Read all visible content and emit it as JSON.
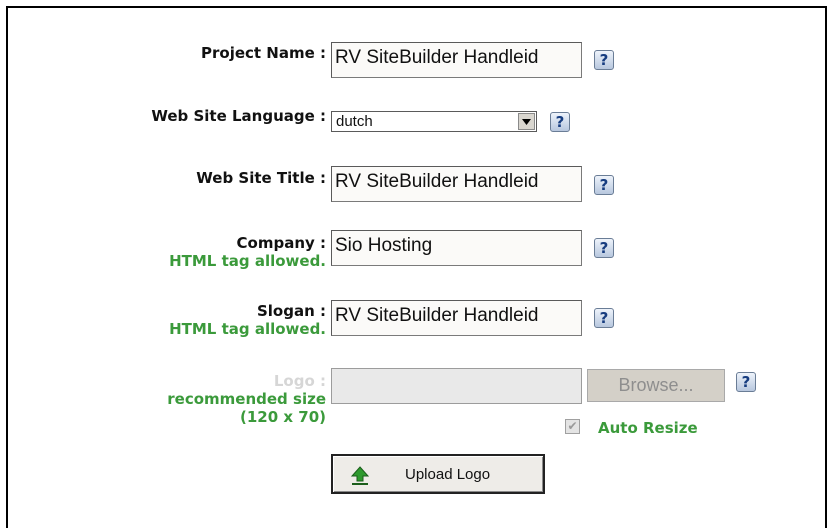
{
  "form": {
    "project_name": {
      "label": "Project Name :",
      "value": "RV SiteBuilder Handleid",
      "help": "?"
    },
    "language": {
      "label": "Web Site Language :",
      "value": "dutch",
      "help": "?"
    },
    "site_title": {
      "label": "Web Site Title :",
      "value": "RV SiteBuilder Handleid",
      "help": "?"
    },
    "company": {
      "label": "Company :",
      "note": "HTML tag allowed.",
      "value": "Sio Hosting",
      "help": "?"
    },
    "slogan": {
      "label": "Slogan :",
      "note": "HTML tag allowed.",
      "value": "RV SiteBuilder Handleid",
      "help": "?"
    },
    "logo": {
      "label": "Logo :",
      "note_line1": "recommended size",
      "note_line2": "(120 x 70)",
      "value": "",
      "browse_label": "Browse...",
      "help": "?",
      "auto_resize_label": "Auto Resize",
      "auto_resize_checked": true
    },
    "upload_button_label": "Upload Logo"
  },
  "icons": {
    "help": "question-mark-icon",
    "dropdown": "dropdown-arrow-icon",
    "upload": "green-upload-arrow-icon"
  },
  "colors": {
    "note_green": "#3b9a3b",
    "help_blue": "#173d80"
  }
}
